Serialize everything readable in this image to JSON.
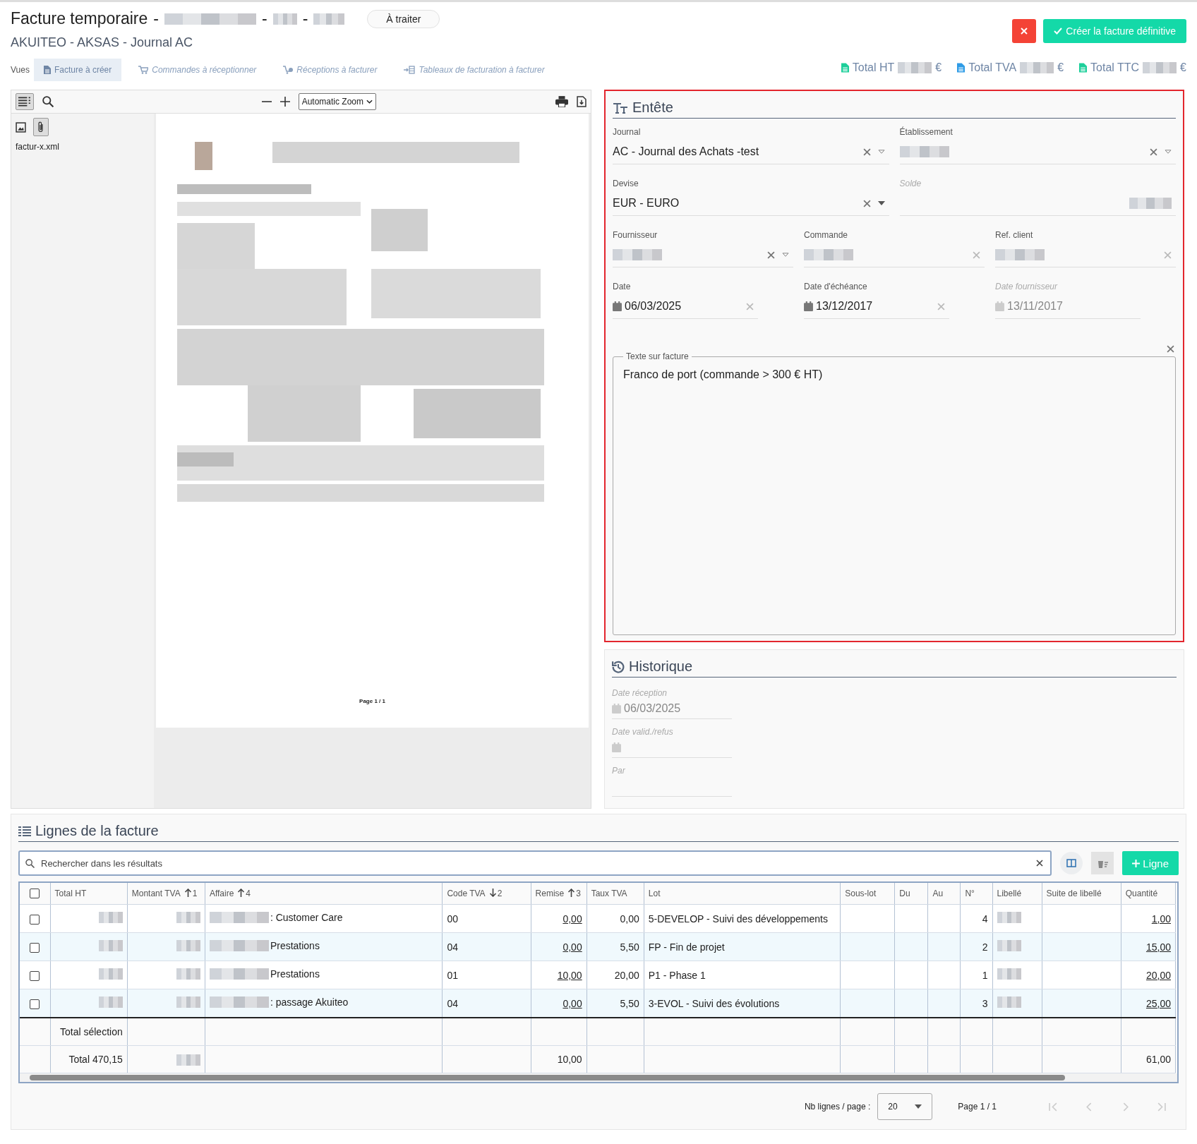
{
  "header": {
    "title": "Facture temporaire",
    "title_suffixes": [
      {
        "separator": "-",
        "redacted": true
      },
      {
        "separator": "-",
        "redacted": true
      },
      {
        "separator": "-",
        "redacted": true
      }
    ],
    "status": "À traiter",
    "subtitle": "AKUITEO - AKSAS - Journal AC",
    "primary_button": "Créer la facture définitive"
  },
  "views": {
    "label": "Vues",
    "items": [
      {
        "label": "Facture à créer",
        "selected": true
      },
      {
        "label": "Commandes à réceptionner",
        "selected": false
      },
      {
        "label": "Réceptions à facturer",
        "selected": false
      },
      {
        "label": "Tableaux de facturation à facturer",
        "selected": false
      }
    ]
  },
  "totals": [
    {
      "label": "Total HT",
      "currency": "€",
      "color": "#1ccf9a"
    },
    {
      "label": "Total TVA",
      "currency": "€",
      "color": "#2e9be6"
    },
    {
      "label": "Total TTC",
      "currency": "€",
      "color": "#1ccf9a"
    }
  ],
  "viewer": {
    "zoom": "Automatic Zoom",
    "attachment": "factur-x.xml",
    "page_label": "Page 1 / 1"
  },
  "entete": {
    "title": "Entête",
    "rows": [
      [
        {
          "label": "Journal",
          "kind": "select",
          "value": "AC - Journal des Achats -test",
          "disabled": false
        },
        {
          "label": "Établissement",
          "kind": "select",
          "redacted": true,
          "disabled": false
        }
      ],
      [
        {
          "label": "Devise",
          "kind": "dropdown",
          "value": "EUR - EURO",
          "disabled": false
        },
        {
          "label": "Solde",
          "kind": "amount",
          "redacted": true,
          "disabled": true
        }
      ],
      [
        {
          "label": "Fournisseur",
          "kind": "select",
          "redacted": true,
          "disabled": false
        },
        {
          "label": "Commande",
          "kind": "text",
          "redacted": true,
          "disabled": false
        },
        {
          "label": "Ref. client",
          "kind": "text",
          "redacted": true,
          "disabled": false
        }
      ],
      [
        {
          "label": "Date",
          "kind": "date",
          "value": "06/03/2025",
          "disabled": false
        },
        {
          "label": "Date d'échéance",
          "kind": "date",
          "value": "13/12/2017",
          "disabled": false
        },
        {
          "label": "Date fournisseur",
          "kind": "date",
          "value": "13/11/2017",
          "disabled": true
        }
      ]
    ],
    "note": {
      "legend": "Texte sur facture",
      "value": "Franco de port (commande > 300 € HT)"
    }
  },
  "historique": {
    "title": "Historique",
    "fields": [
      {
        "label": "Date réception",
        "kind": "date",
        "value": "06/03/2025"
      },
      {
        "label": "Date valid./refus",
        "kind": "date"
      },
      {
        "label": "Par",
        "kind": "text"
      }
    ]
  },
  "lines": {
    "title": "Lignes de la facture",
    "search_placeholder": "Rechercher dans les résultats",
    "add_button": "Ligne",
    "select_all": {
      "checked": false
    },
    "columns": [
      {
        "label": "Total HT"
      },
      {
        "label": "Montant TVA",
        "sort": {
          "descending": false,
          "order": "1"
        }
      },
      {
        "label": "Affaire",
        "sort": {
          "descending": false,
          "order": "4"
        }
      },
      {
        "label": "Code TVA",
        "sort": {
          "descending": true,
          "order": "2"
        }
      },
      {
        "label": "Remise",
        "sort": {
          "descending": false,
          "order": "3"
        }
      },
      {
        "label": "Taux TVA"
      },
      {
        "label": "Lot"
      },
      {
        "label": "Sous-lot"
      },
      {
        "label": "Du"
      },
      {
        "label": "Au"
      },
      {
        "label": "N°"
      },
      {
        "label": "Libellé"
      },
      {
        "label": "Suite de libellé"
      },
      {
        "label": "Quantité"
      }
    ],
    "rows": [
      {
        "checked": false,
        "cells": [
          {
            "redacted": true
          },
          {
            "redacted": true
          },
          {
            "redacted": true,
            "text": ": Customer Care"
          },
          {
            "text": "00"
          },
          {
            "text": "0,00",
            "link": true
          },
          {
            "text": "0,00"
          },
          {
            "text": "5-DEVELOP - Suivi des développements"
          },
          {},
          {},
          {},
          {
            "text": "4"
          },
          {
            "redacted": true
          },
          {},
          {
            "text": "1,00",
            "link": true
          }
        ]
      },
      {
        "checked": false,
        "cells": [
          {
            "redacted": true
          },
          {
            "redacted": true
          },
          {
            "redacted": true,
            "text": "Prestations"
          },
          {
            "text": "04"
          },
          {
            "text": "0,00",
            "link": true
          },
          {
            "text": "5,50"
          },
          {
            "text": "FP - Fin de projet"
          },
          {},
          {},
          {},
          {
            "text": "2"
          },
          {
            "redacted": true
          },
          {},
          {
            "text": "15,00",
            "link": true
          }
        ]
      },
      {
        "checked": false,
        "cells": [
          {
            "redacted": true
          },
          {
            "redacted": true
          },
          {
            "redacted": true,
            "text": "Prestations"
          },
          {
            "text": "01"
          },
          {
            "text": "10,00",
            "link": true
          },
          {
            "text": "20,00"
          },
          {
            "text": "P1 - Phase 1"
          },
          {},
          {},
          {},
          {
            "text": "1"
          },
          {
            "redacted": true
          },
          {},
          {
            "text": "20,00",
            "link": true
          }
        ]
      },
      {
        "checked": false,
        "cells": [
          {
            "redacted": true
          },
          {
            "redacted": true
          },
          {
            "redacted": true,
            "text": ": passage Akuiteo"
          },
          {
            "text": "04"
          },
          {
            "text": "0,00",
            "link": true
          },
          {
            "text": "5,50"
          },
          {
            "text": "3-EVOL - Suivi des évolutions"
          },
          {},
          {},
          {},
          {
            "text": "3"
          },
          {
            "redacted": true
          },
          {},
          {
            "text": "25,00",
            "link": true
          }
        ]
      }
    ],
    "footer_rows": [
      {
        "cells": [
          {
            "text": "Total sélection"
          },
          {},
          {},
          {},
          {},
          {},
          {},
          {},
          {},
          {},
          {},
          {},
          {},
          {}
        ]
      },
      {
        "cells": [
          {
            "text": "Total 470,15"
          },
          {
            "redacted": true
          },
          {},
          {},
          {
            "text": "10,00"
          },
          {},
          {},
          {},
          {},
          {},
          {},
          {},
          {},
          {
            "text": "61,00"
          }
        ]
      }
    ],
    "pagination": {
      "per_page_label": "Nb lignes / page :",
      "per_page": "20",
      "page": "Page 1 / 1"
    }
  }
}
